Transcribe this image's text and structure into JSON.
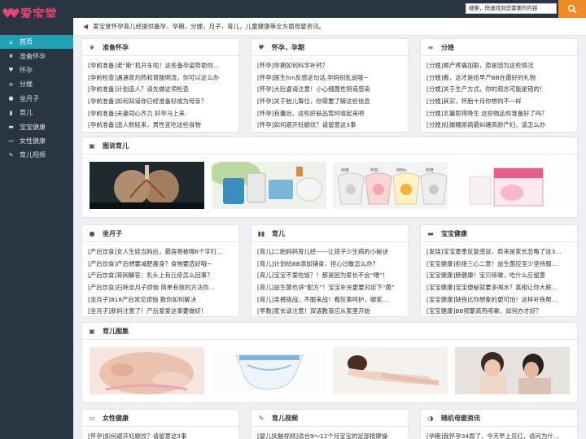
{
  "brand": {
    "logo_text": "爱宝堂"
  },
  "search": {
    "placeholder": "搜索，快速找到您需要的内容"
  },
  "sidebar": {
    "items": [
      {
        "label": "首页",
        "icon": "home-icon",
        "glyph": "⌂"
      },
      {
        "label": "准备怀孕",
        "icon": "leaf-icon",
        "glyph": "❦"
      },
      {
        "label": "怀孕",
        "icon": "heart-icon",
        "glyph": "♥"
      },
      {
        "label": "分娩",
        "icon": "list-icon",
        "glyph": "≡"
      },
      {
        "label": "坐月子",
        "icon": "user-icon",
        "glyph": "●"
      },
      {
        "label": "育儿",
        "icon": "pause-icon",
        "glyph": "▮"
      },
      {
        "label": "宝宝健康",
        "icon": "book-icon",
        "glyph": "▬"
      },
      {
        "label": "女性健康",
        "icon": "monitor-icon",
        "glyph": "▭"
      },
      {
        "label": "育儿视频",
        "icon": "edit-icon",
        "glyph": "✎"
      }
    ]
  },
  "notice": {
    "text": "爱宝堂怀孕育儿经提供备孕，孕期，分娩，月子，育儿，儿童健康等全方面母婴资讯。"
  },
  "sections": {
    "prepare": {
      "title": "准备怀孕",
      "items": [
        "[孕前准备]老“斯”机开车啦！这些备孕姿势助你...",
        "[孕前检查]遇遇胃灼热和胃酸倒流，你可以这么办",
        "[孕前准备]计划造人？请先做这项检查",
        "[孕前准备]如何知道你已经准备好成为母亲？",
        "[孕前准备]夫妻同心齐力 好孕马上来",
        "[孕前准备]造人盼娃来，男性宜吃这些食物"
      ]
    },
    "pregnancy": {
      "title": "怀孕，孕期",
      "items": [
        "[怀孕]孕期如何科学补钙？",
        "[怀孕]医生hin反感这句话,孕妈别乱说哦~",
        "[怀孕]大肚婆请注意！小心细菌性阴道感染",
        "[怀孕]关于胎儿臀位，你需要了解这些信息",
        "[怀孕]有囊后，这些肝肤品暂时收起来吧",
        "[怀孕]如何避开妊娠纹？请留意这3事"
      ]
    },
    "birth": {
      "title": "分娩",
      "items": [
        "[分娩]顺产疼痛加剧，原是因为这些情况",
        "[分娩]看，这才是给早产BB在最好的礼物",
        "[分娩]关于生产方式，你的观念可能是错的！",
        "[分娩]其实，怀胎十月你想的不一样",
        "[分娩]北曩即将降生 这些物品你准备好了吗？",
        "[分娩]妊娠糖尿病最纠缠高龄产妇，该怎么办"
      ]
    },
    "gallery1": {
      "title": "图说育儿"
    },
    "confinement": {
      "title": "坐月子",
      "items": [
        "[产后饮食]女人生娃当妈后，最容易被哪6个字打...",
        "[产后饮食]产后想要减肥瘦身？食物要选好哦~",
        "[产后饮食]育网解答：乳头上有丘疹怎么回事？",
        "[产后饮食]扫除坐月子烦恼 简单有效的方法你...",
        "[坐月子]818产后常见烦恼 教你如何解决",
        "[坐月子]新妈注意了！产后爱爱这事要做好！"
      ]
    },
    "parenting": {
      "title": "育儿",
      "items": [
        "[育儿]二胎妈妈育儿经——让孩子少生病的小秘诀",
        "[育儿]计划给BB添加辅食，担心过敏怎么办？",
        "[育儿]宝宝不爱吃饭？！那是因为家长不会“喂”！",
        "[育儿]益生菌也讲“配方”！宝宝补充更要对症下“菌”",
        "[育儿]亲裤挑战，不服来战！看狂事呵护，哪家...",
        "[早教]家长请注意！双语教育应从家里开始"
      ]
    },
    "babyhealth": {
      "title": "宝宝健康",
      "items": [
        "[发烧]宝宝夏季反复感冒，原来是家长忽略了这3...",
        "[宝宝健康]拒绝三心二意！益生菌应至少坚持服...",
        "[宝宝健康]肠健康！宝贝咳嗽，吃什么应留意",
        "[宝宝健康]宝宝便秘就要多喝水？真相让你大跌...",
        "[宝宝健康]缺铁比你想象的更可怕！这样补铁帮...",
        "[宝宝健康]BB频繁高热咳嗽，如何办才好？"
      ]
    },
    "gallery2": {
      "title": "育儿图集"
    },
    "women": {
      "title": "女性健康",
      "items": [
        "[怀孕]如何避开妊娠纹？请留意这3事"
      ]
    },
    "video": {
      "title": "育儿视频",
      "items": [
        "[婴儿抚触视频]适合9～12个月宝宝的足部按摩操"
      ]
    },
    "random": {
      "title": "随机母婴资讯",
      "items": [
        "[孕期]我怀孕34周了，今天早上见红，请问为什..."
      ]
    }
  },
  "colors": {
    "sidebar": "#2a3542",
    "active": "#1fa2b4",
    "search_button": "#f08a24",
    "logo": "#e6456f"
  }
}
